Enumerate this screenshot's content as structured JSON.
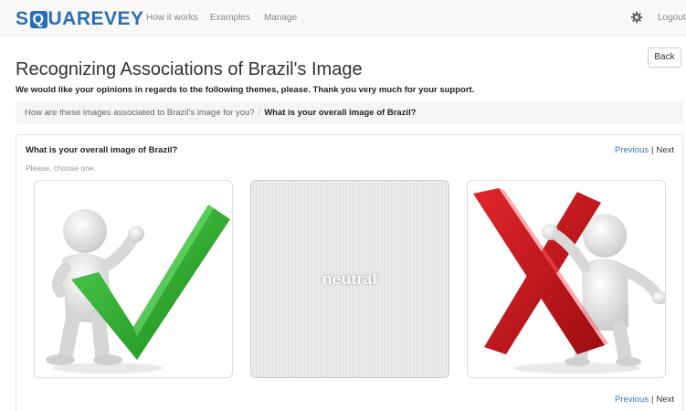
{
  "brand": {
    "prefix": "S",
    "accent_letter": "Q",
    "suffix": "UAREVEY",
    "color": "#2a6fb5"
  },
  "nav": {
    "links": [
      "How it works",
      "Examples",
      "Manage"
    ],
    "settings_icon": "gear-icon",
    "logout": "Logout"
  },
  "page": {
    "title": "Recognizing Associations of Brazil's Image",
    "back_label": "Back",
    "intro": "We would like your opinions in regards to the following themes, please. Thank you very much for your support."
  },
  "breadcrumb": {
    "parent": "How are these images associated to Brazil's image for you?",
    "separator": "/",
    "current": "What is your overall image of Brazil?"
  },
  "question": {
    "title": "What is your overall image of Brazil?",
    "hint": "Please, choose one.",
    "options": [
      {
        "id": "positive",
        "icon": "checkmark-figure-icon",
        "accent": "#2a9d2a"
      },
      {
        "id": "neutral",
        "label": "neutral"
      },
      {
        "id": "negative",
        "icon": "x-mark-figure-icon",
        "accent": "#c8151b"
      }
    ]
  },
  "pager": {
    "previous": "Previous",
    "separator": "|",
    "next": "Next"
  }
}
